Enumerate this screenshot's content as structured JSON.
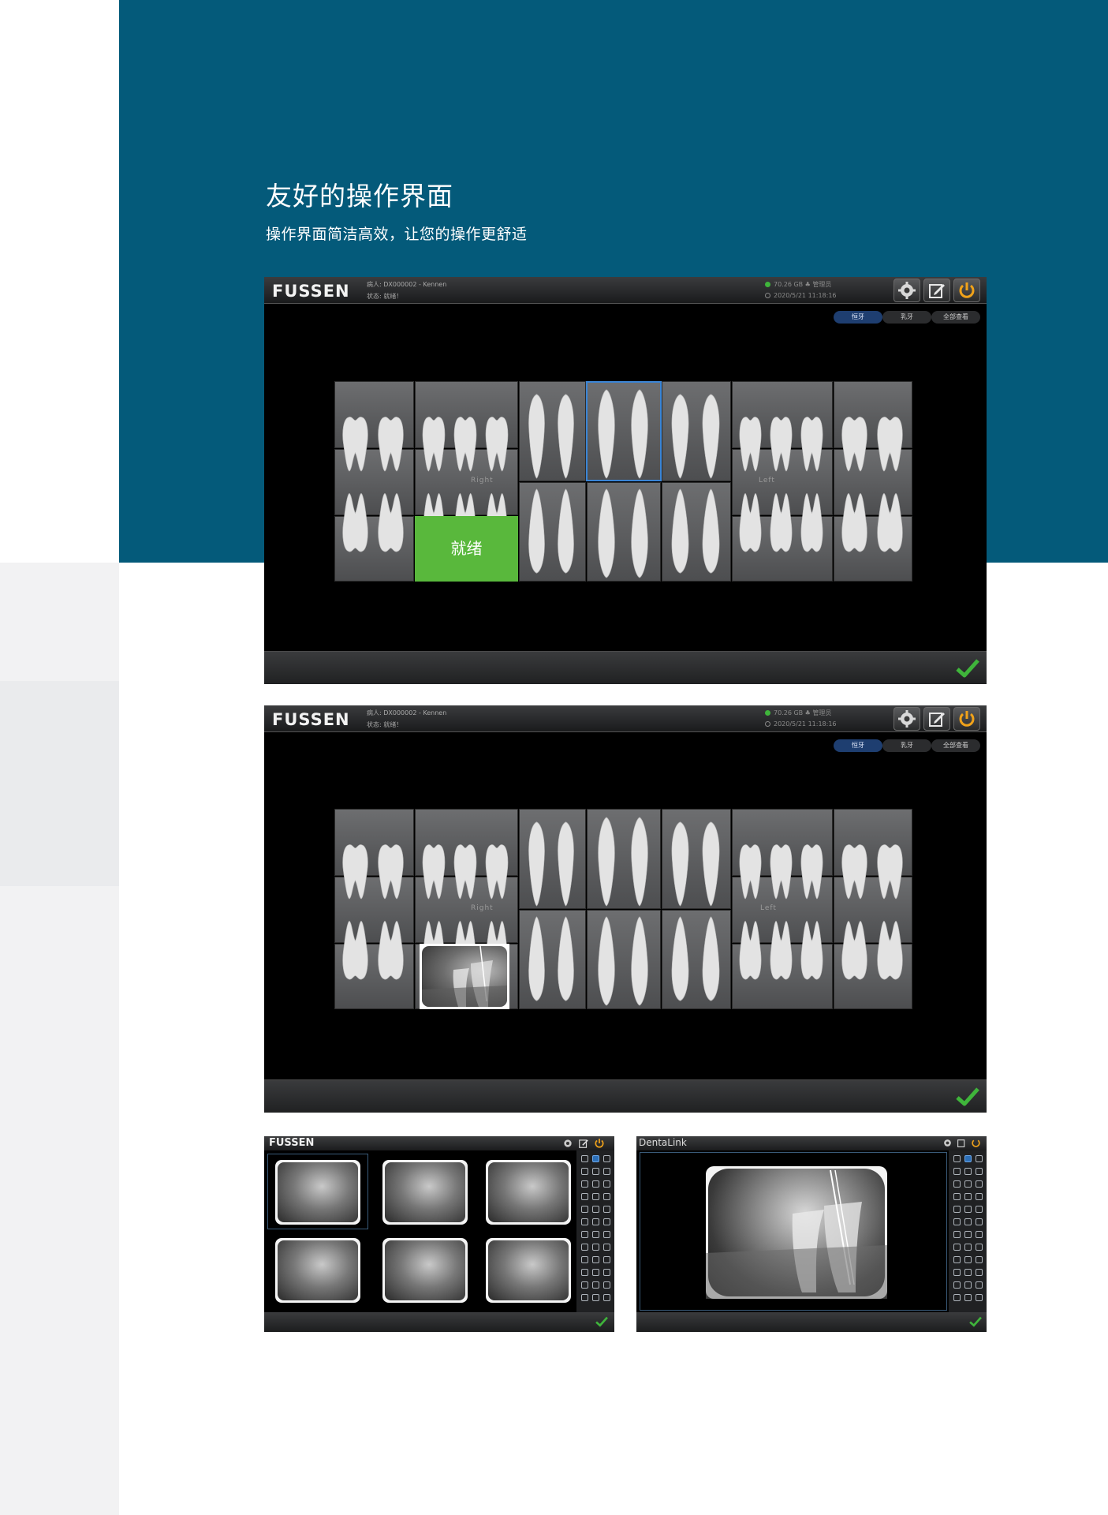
{
  "page": {
    "headline": "友好的操作界面",
    "subline": "操作界面简洁高效，让您的操作更舒适"
  },
  "app": {
    "logo": "FUSSEN",
    "patient": "病人: DX000002 - Kennen",
    "status": "状态: 就绪！",
    "disk": "70.26 GB  ♣  管理员",
    "datetime": "2020/5/21 11:18:16",
    "icons": [
      "gear-icon",
      "edit-icon",
      "power-icon"
    ],
    "tabs": [
      {
        "label": "恒牙",
        "active": true
      },
      {
        "label": "乳牙",
        "active": false
      },
      {
        "label": "全部查看",
        "active": false
      }
    ],
    "chart": {
      "right_label": "Right",
      "left_label": "Left",
      "ready_label": "就绪"
    },
    "confirm_icon": "checkmark-icon"
  },
  "mini_screens": {
    "left_logo": "FUSSEN",
    "right_logo": "DentaLink"
  },
  "colors": {
    "band": "#045a7a",
    "ready": "#59b83c",
    "active_tab": "#1e3e70",
    "selection": "#3a85d6",
    "confirm": "#3fb53b"
  }
}
